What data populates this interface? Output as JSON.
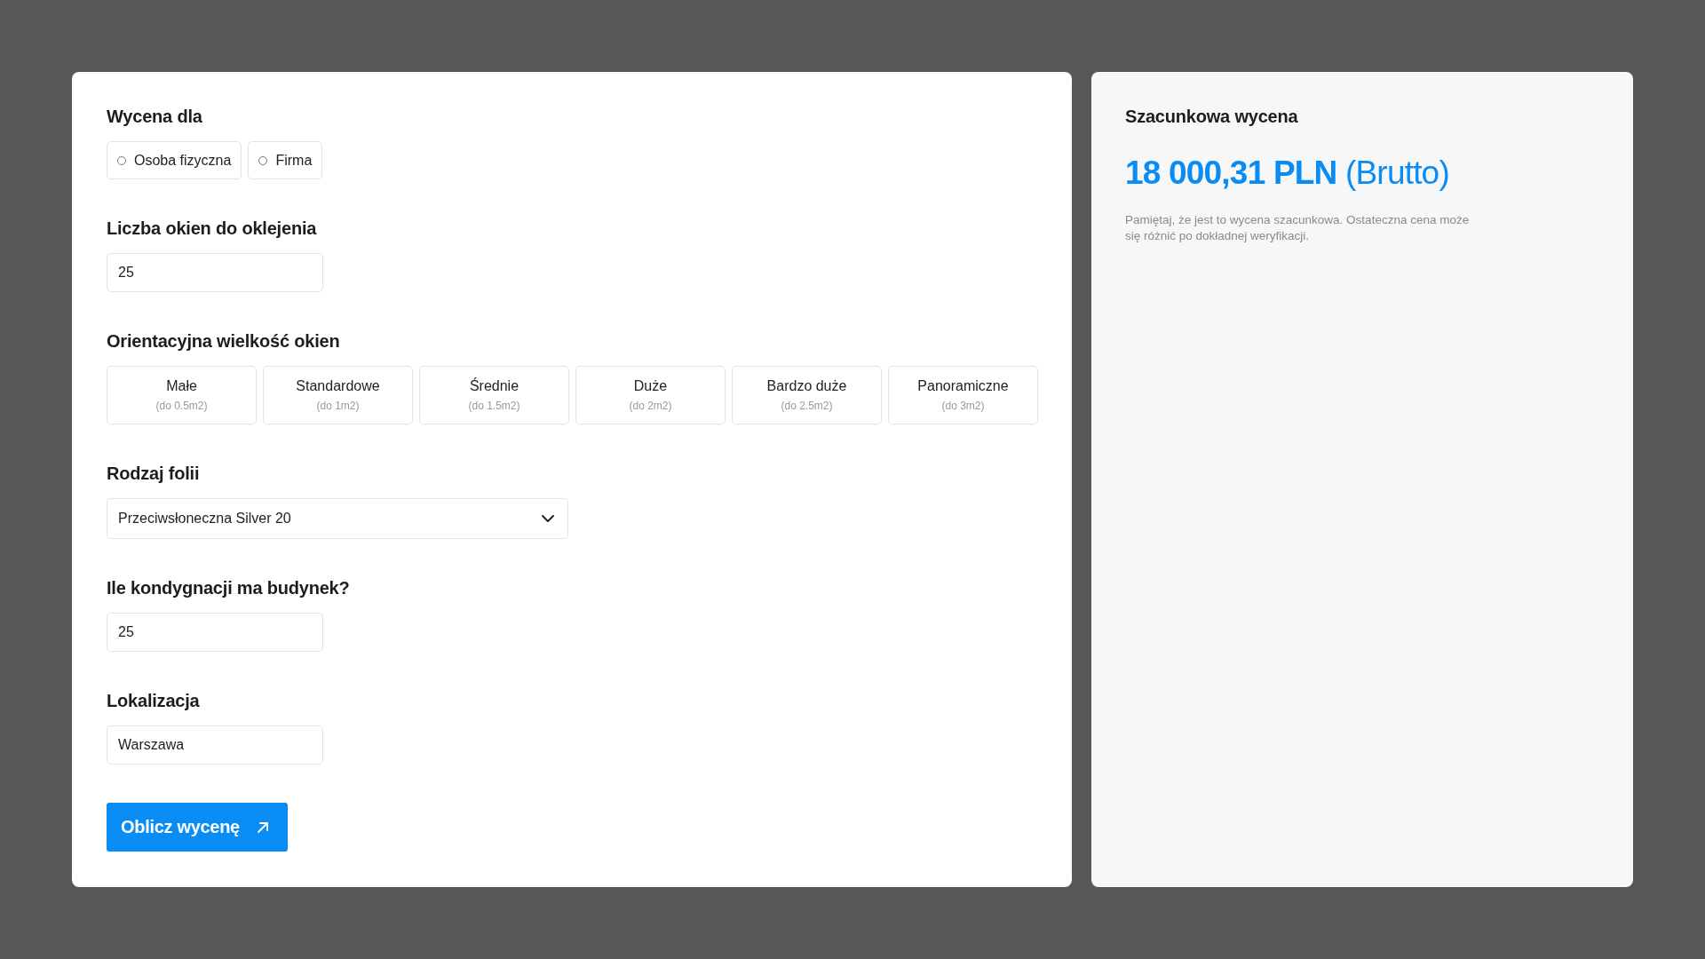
{
  "form": {
    "client_type": {
      "label": "Wycena dla",
      "options": [
        {
          "label": "Osoba fizyczna",
          "selected": false
        },
        {
          "label": "Firma",
          "selected": false
        }
      ]
    },
    "window_count": {
      "label": "Liczba okien do oklejenia",
      "value": "25"
    },
    "window_size": {
      "label": "Orientacyjna wielkość okien",
      "options": [
        {
          "name": "Małe",
          "hint": "(do 0.5m2)",
          "selected": false
        },
        {
          "name": "Standardowe",
          "hint": "(do 1m2)",
          "selected": false
        },
        {
          "name": "Średnie",
          "hint": "(do 1.5m2)",
          "selected": false
        },
        {
          "name": "Duże",
          "hint": "(do 2m2)",
          "selected": false
        },
        {
          "name": "Bardzo duże",
          "hint": "(do 2.5m2)",
          "selected": false
        },
        {
          "name": "Panoramiczne",
          "hint": "(do 3m2)",
          "selected": false
        }
      ]
    },
    "film_type": {
      "label": "Rodzaj folii",
      "value": "Przeciwsłoneczna Silver 20"
    },
    "floors": {
      "label": "Ile kondygnacji ma budynek?",
      "value": "25"
    },
    "location": {
      "label": "Lokalizacja",
      "value": "Warszawa"
    },
    "submit": {
      "label": "Oblicz wycenę"
    }
  },
  "estimate": {
    "title": "Szacunkowa wycena",
    "amount": "18 000,31 PLN",
    "suffix": "(Brutto)",
    "note": "Pamiętaj, że jest to wycena szacunkowa. Ostateczna cena może się różnić po dokładnej weryfikacji."
  }
}
